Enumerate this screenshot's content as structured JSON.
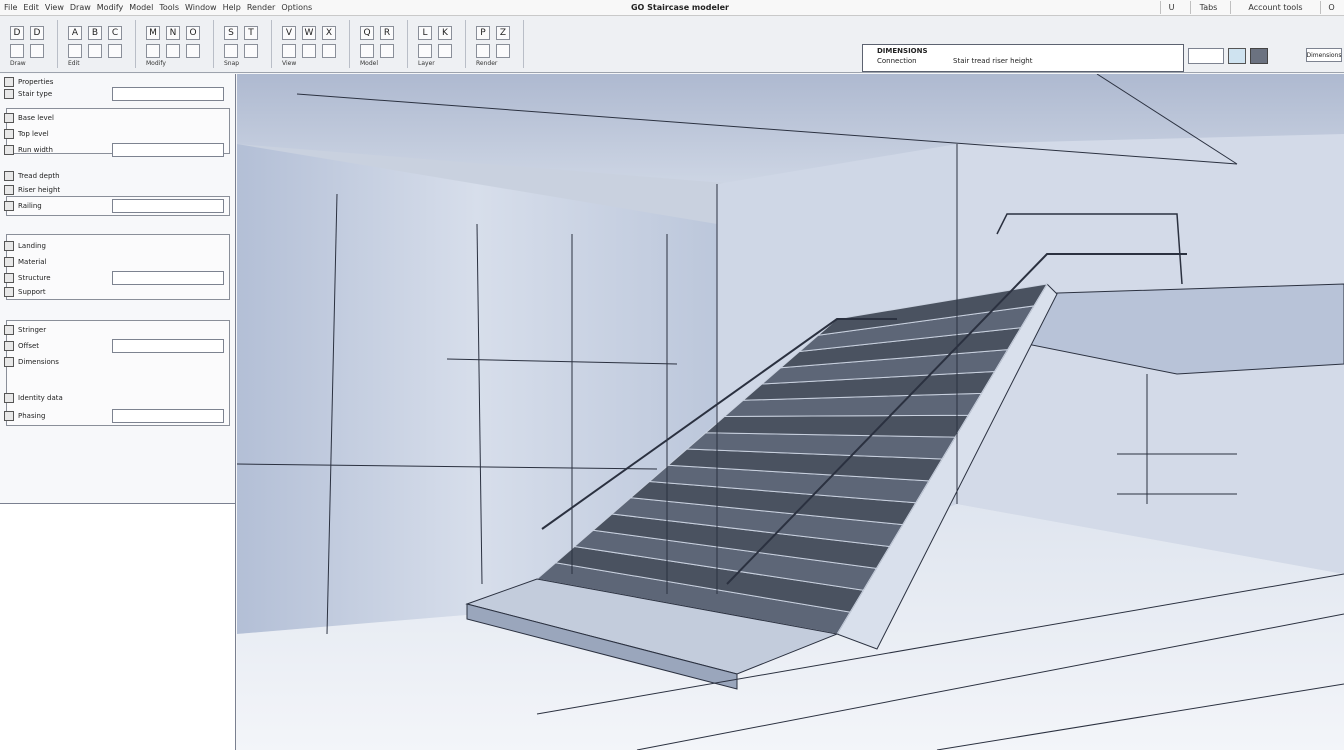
{
  "app": {
    "title": "GO Staircase modeler"
  },
  "menubar": {
    "items": [
      "File",
      "Edit",
      "View",
      "Draw",
      "Modify",
      "Model",
      "Tools",
      "Window",
      "Help",
      "Render",
      "Options"
    ]
  },
  "window_controls": {
    "minimize": "U",
    "restore": "Tabs",
    "account": "Account tools",
    "close": "O"
  },
  "toolbar": {
    "groups": [
      {
        "label": "Draw",
        "buttons": [
          "D",
          "D"
        ]
      },
      {
        "label": "Edit",
        "buttons": [
          "A",
          "B",
          "C"
        ]
      },
      {
        "label": "Modify",
        "buttons": [
          "M",
          "N",
          "O"
        ]
      },
      {
        "label": "Snap",
        "buttons": [
          "S",
          "T"
        ]
      },
      {
        "label": "View",
        "buttons": [
          "V",
          "W",
          "X"
        ]
      },
      {
        "label": "Model",
        "buttons": [
          "Q",
          "R"
        ]
      },
      {
        "label": "Layer",
        "buttons": [
          "L",
          "K"
        ]
      },
      {
        "label": "Render",
        "buttons": [
          "P",
          "Z"
        ]
      }
    ],
    "right_label": "Dimensions",
    "info": {
      "line1": "DIMENSIONS",
      "line2": "Connection",
      "line3": "Stair tread riser height"
    }
  },
  "panel": {
    "rows": [
      {
        "label": "Properties"
      },
      {
        "label": "Stair type"
      },
      {
        "label": "Base level"
      },
      {
        "label": "Top level"
      },
      {
        "label": "Run width"
      },
      {
        "label": "Tread depth"
      },
      {
        "label": "Riser height"
      },
      {
        "label": "Railing"
      },
      {
        "label": "Landing"
      },
      {
        "label": "Material"
      },
      {
        "label": "Structure"
      },
      {
        "label": "Support"
      },
      {
        "label": "Stringer"
      },
      {
        "label": "Offset"
      },
      {
        "label": "Dimensions"
      },
      {
        "label": "Identity data"
      },
      {
        "label": "Phasing"
      }
    ]
  },
  "colors": {
    "viewport_bg": "#c9d1df",
    "stair_dark": "#4a5260",
    "line": "#2b3140"
  }
}
